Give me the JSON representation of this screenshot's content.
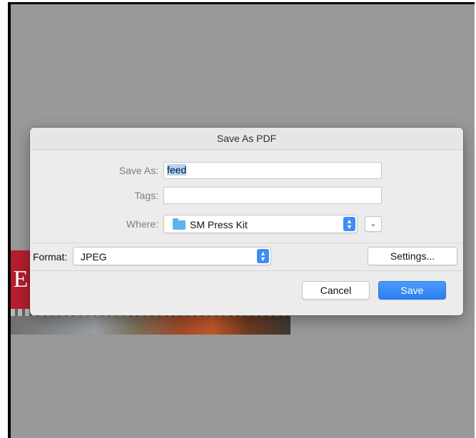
{
  "dialog": {
    "title": "Save As PDF",
    "save_as": {
      "label": "Save As:",
      "value": "feed"
    },
    "tags": {
      "label": "Tags:",
      "value": ""
    },
    "where": {
      "label": "Where:",
      "value": "SM Press Kit"
    },
    "format": {
      "label": "Format:",
      "value": "JPEG"
    },
    "settings_label": "Settings...",
    "cancel_label": "Cancel",
    "save_label": "Save"
  },
  "background": {
    "fragment_text": "E"
  },
  "icons": {
    "folder": "folder-icon",
    "popup_arrows": "up-down-chevron-icon",
    "expand": "chevron-down-icon"
  },
  "colors": {
    "accent": "#2a7ff1",
    "folder": "#5eb2ee",
    "overlay": "#999999",
    "brand_red": "#b61e2e"
  }
}
